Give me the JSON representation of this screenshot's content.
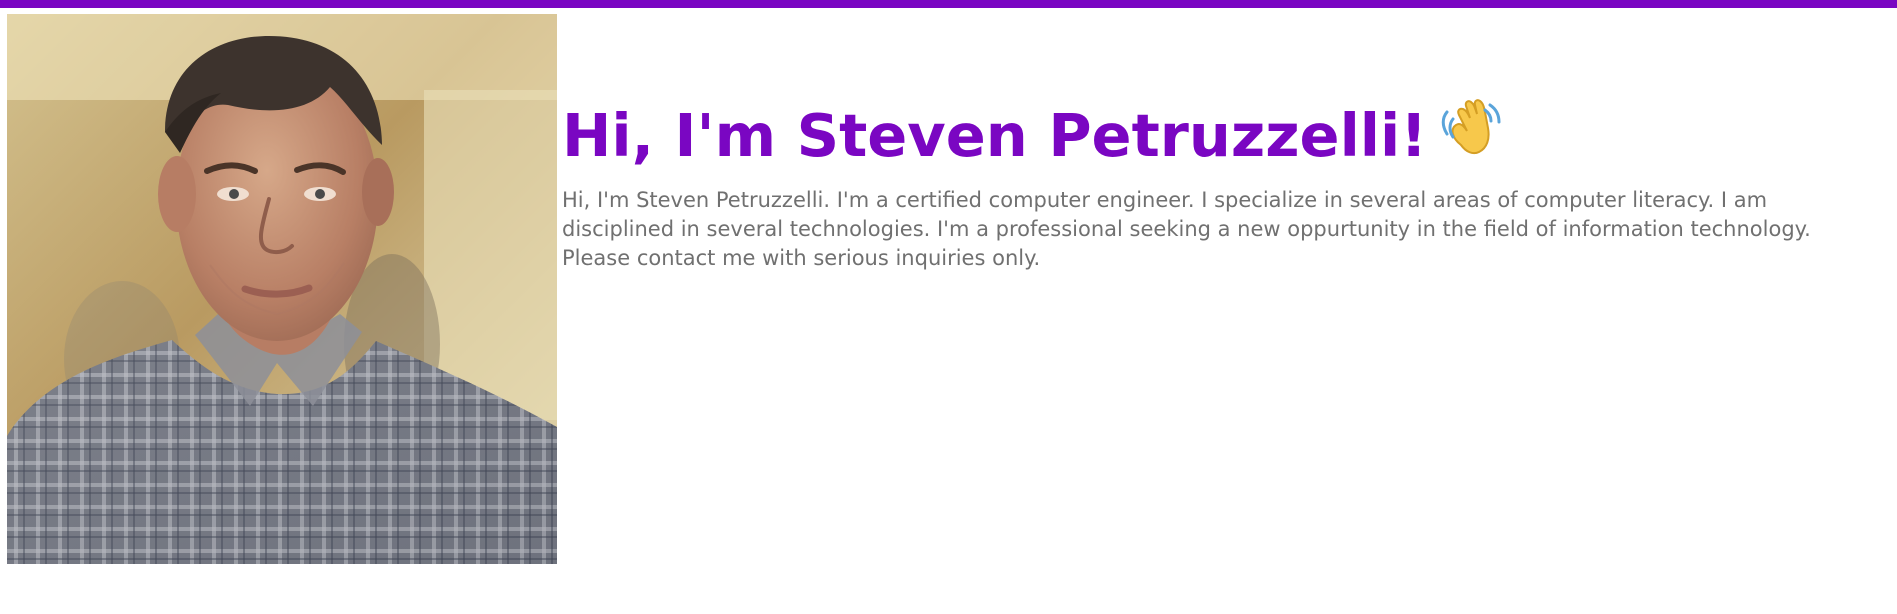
{
  "header": {
    "accent_color": "#7a06c2"
  },
  "profile": {
    "photo_alt": "Steven Petruzzelli",
    "photo_icon": "profile-photo"
  },
  "intro": {
    "greeting": "Hi, I'm Steven Petruzzelli!",
    "greeting_icon": "waving-hand-icon",
    "bio": "Hi, I'm Steven Petruzzelli. I'm a certified computer engineer. I specialize in several areas of computer literacy. I am disciplined in several technologies. I'm a professional seeking a new oppurtunity in the field of information technology. Please contact me with serious inquiries only.",
    "text_color": "#707070"
  }
}
